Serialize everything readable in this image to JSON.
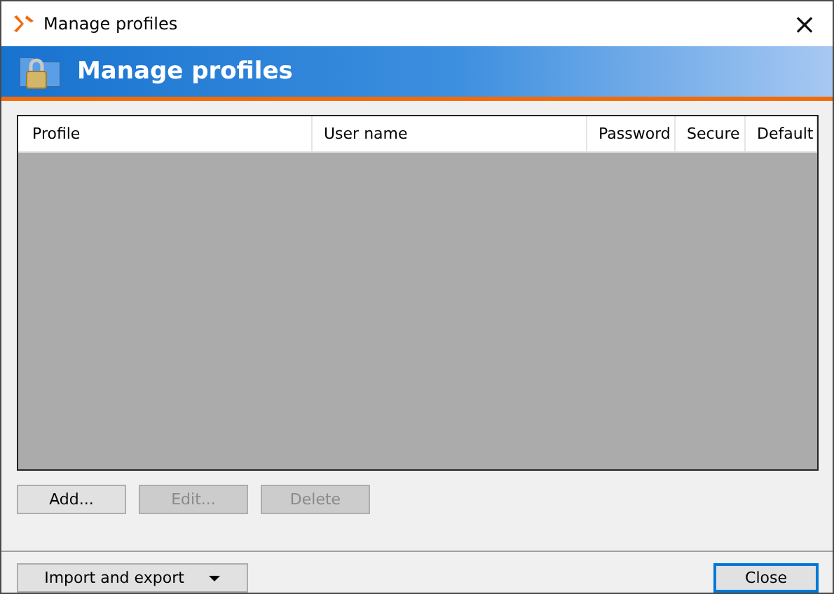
{
  "window": {
    "title": "Manage profiles",
    "close_glyph": "×"
  },
  "banner": {
    "title": "Manage profiles"
  },
  "table": {
    "columns": [
      "Profile",
      "User name",
      "Password",
      "Secure",
      "Default"
    ]
  },
  "actions": [
    {
      "label": "Add...",
      "disabled": false
    },
    {
      "label": "Edit...",
      "disabled": true
    },
    {
      "label": "Delete",
      "disabled": true
    }
  ],
  "footer": {
    "menu_button": {
      "label": "Import and export"
    },
    "close_button": {
      "label": "Close",
      "focused": true
    }
  }
}
